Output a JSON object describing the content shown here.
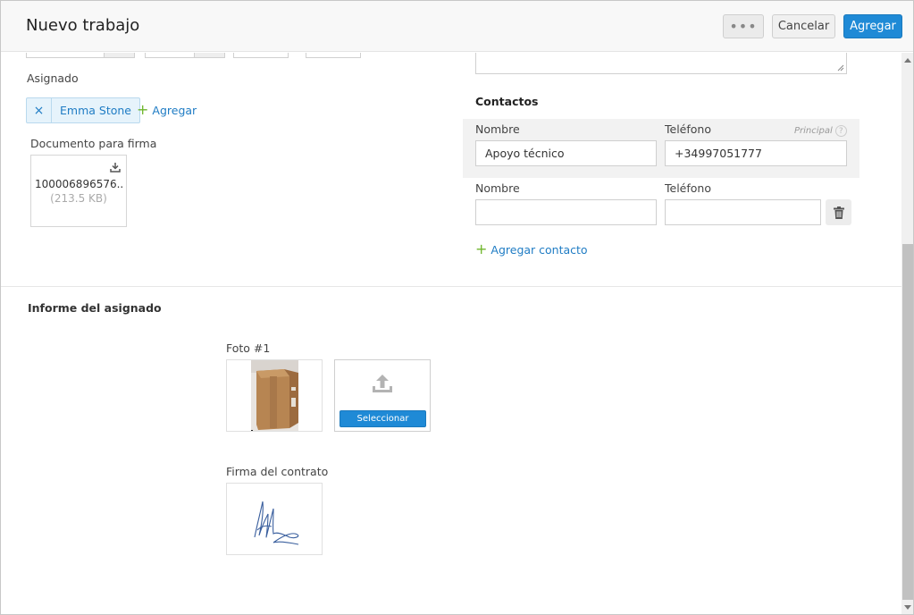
{
  "header": {
    "title": "Nuevo trabajo",
    "more_label": "•••",
    "cancel_label": "Cancelar",
    "add_label": "Agregar"
  },
  "assignee": {
    "label": "Asignado",
    "chip_remove": "×",
    "name": "Emma Stone",
    "add_label": "Agregar"
  },
  "document": {
    "label": "Documento para firma",
    "file_name": "100006896576....",
    "file_size": "(213.5 KB)"
  },
  "contacts": {
    "title": "Contactos",
    "name_label": "Nombre",
    "phone_label": "Teléfono",
    "principal_label": "Principal",
    "help_icon": "?",
    "rows": [
      {
        "name": "Apoyo técnico",
        "phone": "+34997051777"
      },
      {
        "name": "",
        "phone": ""
      }
    ],
    "add_contact_label": "Agregar contacto"
  },
  "report": {
    "title": "Informe del asignado",
    "photo_label": "Foto #1",
    "select_label": "Seleccionar",
    "signature_label": "Firma del contrato"
  },
  "colors": {
    "primary": "#1f8ad6",
    "add_green": "#6fb52c",
    "link": "#1f7cc4"
  }
}
